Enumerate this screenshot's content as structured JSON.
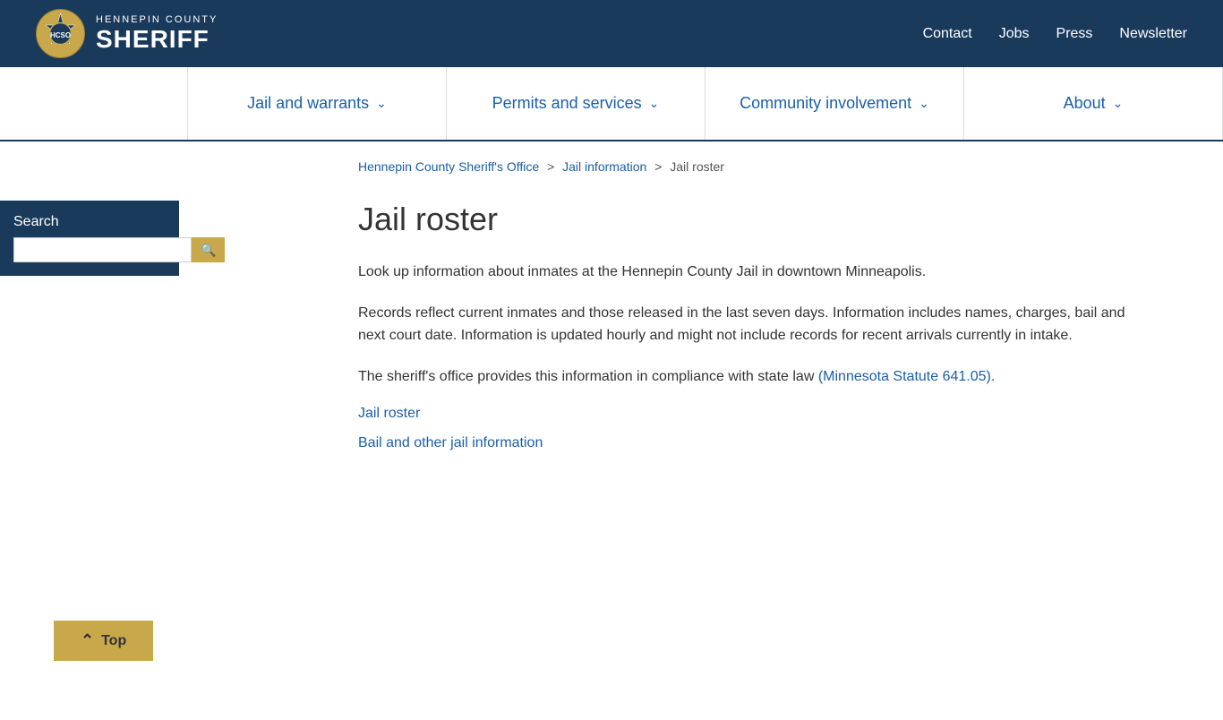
{
  "header": {
    "county": "HENNEPIN COUNTY",
    "title": "SHERIFF",
    "topnav": [
      {
        "label": "Contact",
        "href": "#"
      },
      {
        "label": "Jobs",
        "href": "#"
      },
      {
        "label": "Press",
        "href": "#"
      },
      {
        "label": "Newsletter",
        "href": "#"
      }
    ]
  },
  "mainnav": [
    {
      "label": "Jail and warrants",
      "hasChevron": true
    },
    {
      "label": "Permits and services",
      "hasChevron": true
    },
    {
      "label": "Community involvement",
      "hasChevron": true
    },
    {
      "label": "About",
      "hasChevron": true
    }
  ],
  "breadcrumb": {
    "items": [
      {
        "label": "Hennepin County Sheriff's Office",
        "href": "#"
      },
      {
        "label": "Jail information",
        "href": "#"
      },
      {
        "label": "Jail roster",
        "current": true
      }
    ]
  },
  "sidebar": {
    "search_label": "Search",
    "search_placeholder": "",
    "search_btn_icon": "🔍"
  },
  "main": {
    "page_title": "Jail roster",
    "para1": "Look up information about inmates at the Hennepin County Jail in downtown Minneapolis.",
    "para2": "Records reflect current inmates and those released in the last seven days. Information includes names, charges, bail and next court date. Information is updated hourly and might not include records for recent arrivals currently in intake.",
    "para3": "The sheriff's office provides this information in compliance with state law",
    "statute_link_text": "(Minnesota Statute 641.05).",
    "statute_link_href": "#",
    "jail_roster_link": "Jail roster",
    "bail_link": "Bail and other jail information"
  },
  "top_button": {
    "label": "Top"
  }
}
